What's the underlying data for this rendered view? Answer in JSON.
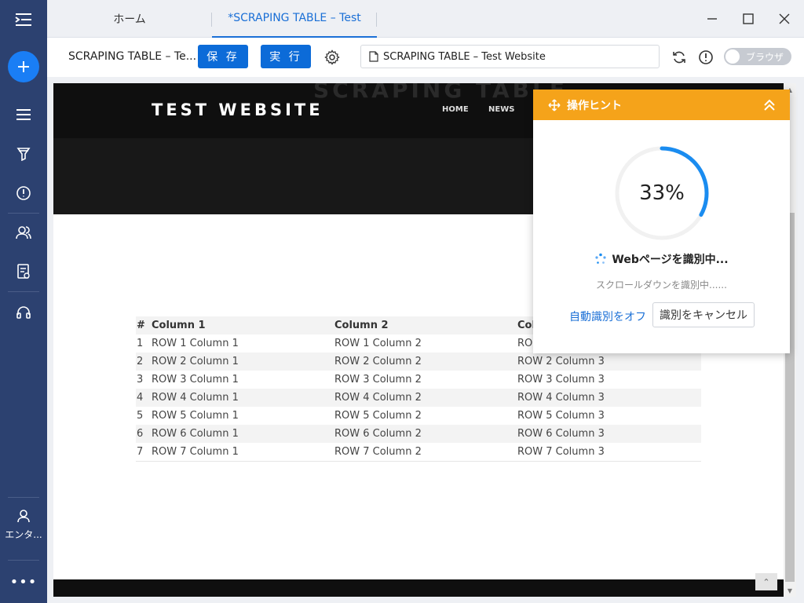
{
  "sidebar": {
    "enterprise_label": "エンタ..."
  },
  "tabs": [
    {
      "label": "ホーム"
    },
    {
      "label": "*SCRAPING TABLE – Test"
    }
  ],
  "toolbar": {
    "task_title": "SCRAPING TABLE – Te...",
    "save_label": "保 存",
    "run_label": "実 行",
    "url": "SCRAPING TABLE – Test Website",
    "browser_toggle_label": "ブラウザ",
    "browser_toggle_on": false
  },
  "website": {
    "ghost_title": "SCRAPING TABLE",
    "logo": "TEST WEBSITE",
    "nav": [
      "HOME",
      "NEWS"
    ],
    "table": {
      "headers": [
        "#",
        "Column 1",
        "Column 2",
        "Col"
      ],
      "rows": [
        [
          "1",
          "ROW 1 Column 1",
          "ROW 1 Column 2",
          "RO"
        ],
        [
          "2",
          "ROW 2 Column 1",
          "ROW 2 Column 2",
          "ROW 2 Column 3"
        ],
        [
          "3",
          "ROW 3 Column 1",
          "ROW 3 Column 2",
          "ROW 3 Column 3"
        ],
        [
          "4",
          "ROW 4 Column 1",
          "ROW 4 Column 2",
          "ROW 4 Column 3"
        ],
        [
          "5",
          "ROW 5 Column 1",
          "ROW 5 Column 2",
          "ROW 5 Column 3"
        ],
        [
          "6",
          "ROW 6 Column 1",
          "ROW 6 Column 2",
          "ROW 6 Column 3"
        ],
        [
          "7",
          "ROW 7 Column 1",
          "ROW 7 Column 2",
          "ROW 7 Column 3"
        ]
      ]
    }
  },
  "hint_panel": {
    "title": "操作ヒント",
    "progress": 0.33,
    "progress_label": "33%",
    "status": "Webページを識別中...",
    "substatus": "スクロールダウンを識別中......",
    "disable_link": "自動識別をオフ",
    "cancel_button": "識別をキャンセル",
    "accent_color": "#f5a31a",
    "progress_color": "#1a8cf0"
  },
  "colors": {
    "sidebar": "#2c4170",
    "primary": "#0c6bd8"
  }
}
